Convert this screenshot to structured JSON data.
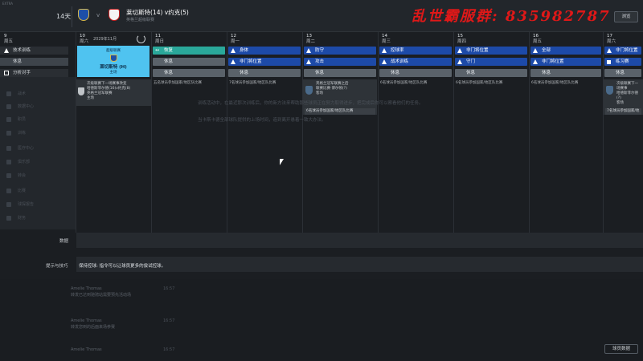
{
  "window": {
    "title": "EXTRA"
  },
  "header": {
    "days_left": "14天",
    "vs": "v",
    "match_title": "莱切斯特(14) v约克(5)",
    "competition": "英格兰超级联赛",
    "overlay_text": "乱世霸服群: 835982787",
    "view_button": "浏览"
  },
  "month_label": "2029年11月",
  "days": [
    {
      "num": "9",
      "name": "周五"
    },
    {
      "num": "10",
      "name": "周六"
    },
    {
      "num": "11",
      "name": "周日"
    },
    {
      "num": "12",
      "name": "周一"
    },
    {
      "num": "13",
      "name": "周二"
    },
    {
      "num": "14",
      "name": "周三"
    },
    {
      "num": "15",
      "name": "周四"
    },
    {
      "num": "16",
      "name": "周五"
    },
    {
      "num": "17",
      "name": "周六"
    }
  ],
  "sidebar": {
    "items": [
      {
        "label": "技术训练"
      },
      {
        "label": "休息"
      },
      {
        "label": "分析对手"
      }
    ],
    "dim_items": [
      "主页",
      "收件箱",
      "队伍",
      "战术",
      "数据中心",
      "职员",
      "训练",
      "医疗中心",
      "俱乐部",
      "转会",
      "比赛",
      "球探报告",
      "财务",
      "青训中心"
    ]
  },
  "match_card": {
    "label": "超级联赛",
    "home": "莱切斯特",
    "score": "(H)",
    "venue": "主场"
  },
  "sessions": {
    "d11": [
      {
        "label": "恢复"
      },
      {
        "label": "休息"
      },
      {
        "label": "休息"
      }
    ],
    "d12": [
      {
        "label": "身体"
      },
      {
        "label": "非门将位置"
      },
      {
        "label": "休息"
      }
    ],
    "d13": [
      {
        "label": "防守"
      },
      {
        "label": "攻击"
      },
      {
        "label": "休息"
      }
    ],
    "d14": [
      {
        "label": "控球率"
      },
      {
        "label": "战术训练"
      },
      {
        "label": "休息"
      }
    ],
    "d15": [
      {
        "label": "非门将位置"
      },
      {
        "label": "守门"
      },
      {
        "label": "休息"
      }
    ],
    "d16": [
      {
        "label": "全部"
      },
      {
        "label": "非门将位置"
      },
      {
        "label": "休息"
      }
    ],
    "d17": [
      {
        "label": "非门将位置"
      },
      {
        "label": "练习赛"
      },
      {
        "label": "休息"
      }
    ]
  },
  "events": {
    "d10": {
      "lines": [
        "次级联赛下一场赛事改变",
        "哈德斯菲尔德(16)v约克(8)",
        "英格兰冠军联赛"
      ],
      "venue": "主场"
    },
    "d11": {
      "bottom": "五名球员参加国家/地区队比赛"
    },
    "d12": {
      "bottom": "7名球员参加国家/地区队比赛"
    },
    "d13": {
      "lines": [
        "英格兰冠军联赛之后",
        "联赛比赛·博尔顿(?)"
      ],
      "venue": "客场",
      "bottom": "6名球员参加国家/地区队比赛"
    },
    "d14": {
      "bottom": "6名球员参加国家/地区队比赛"
    },
    "d15": {
      "bottom": "6名球员参加国家/地区队比赛"
    },
    "d16": {
      "bottom": "6名球员参加国家/地区队比赛"
    },
    "d17": {
      "lines": [
        "次级联赛下一场赛事",
        "哈德斯菲尔德(?)"
      ],
      "venue": "客场",
      "bottom": "7名球员参加国家/地"
    }
  },
  "messages": {
    "line1": "训练活动中，在最近那次训练后，你的新方法来帮助那些球员正在努力取得进步，把完成后你可以察看他们的任务。",
    "line2": "当卡斯卡德全部球队提供的上场时间，造到离开悬着一致大办法。"
  },
  "rows": {
    "data_label": "数据",
    "tips_label": "提示与技巧",
    "tip_text": "保持控球: 指令可以让球员更多的尝试控球。"
  },
  "inbox": [
    {
      "from": "Amelie Thomas",
      "subject": "转发已达到驰骋站需要预先活动场",
      "time": "16:57"
    },
    {
      "from": "Amelie Thomas",
      "subject": "转发您到的后面来场参赛",
      "time": "16:57"
    },
    {
      "from": "Amelie Thomas",
      "subject": "转发已达到驰骋站需要预先活动场",
      "time": "16:57"
    }
  ],
  "bottom_button": "球员数据",
  "colors": {
    "session_blue": "#1d4aa8",
    "session_gray": "#5a626a",
    "match_card": "#4fc3f0",
    "recovery_teal": "#2aa89a",
    "overlay_red": "#e01818"
  }
}
